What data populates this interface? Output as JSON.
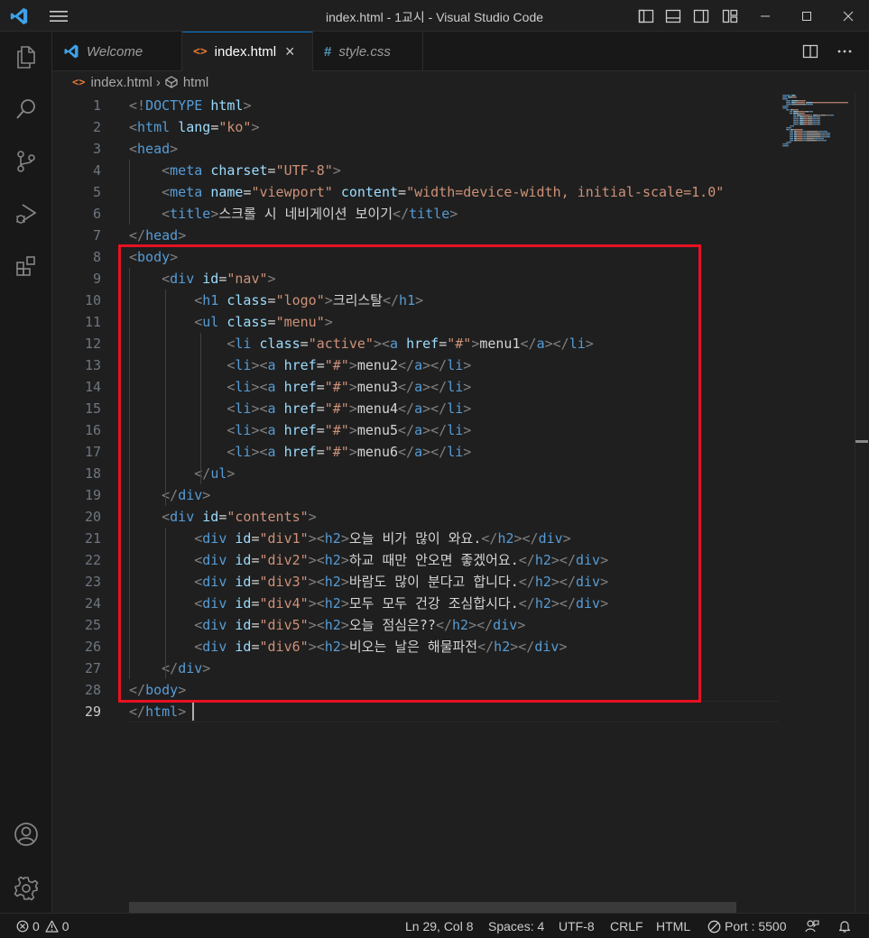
{
  "window": {
    "title": "index.html - 1교시 - Visual Studio Code"
  },
  "tabs": [
    {
      "label": "Welcome",
      "icon": "vscode-icon",
      "active": false
    },
    {
      "label": "index.html",
      "icon": "html-icon",
      "active": true
    },
    {
      "label": "style.css",
      "icon": "css-hash-icon",
      "active": false
    }
  ],
  "breadcrumb": {
    "file": "index.html",
    "symbol": "html"
  },
  "editor": {
    "line_numbers": [
      "1",
      "2",
      "3",
      "4",
      "5",
      "6",
      "7",
      "8",
      "9",
      "10",
      "11",
      "12",
      "13",
      "14",
      "15",
      "16",
      "17",
      "18",
      "19",
      "20",
      "21",
      "22",
      "23",
      "24",
      "25",
      "26",
      "27",
      "28",
      "29"
    ],
    "current_line": "29",
    "lines": [
      [
        [
          "p",
          "<!"
        ],
        [
          "t",
          "DOCTYPE"
        ],
        [
          "x",
          " "
        ],
        [
          "a",
          "html"
        ],
        [
          "p",
          ">"
        ]
      ],
      [
        [
          "p",
          "<"
        ],
        [
          "t",
          "html"
        ],
        [
          "x",
          " "
        ],
        [
          "a",
          "lang"
        ],
        [
          "x",
          "="
        ],
        [
          "s",
          "\"ko\""
        ],
        [
          "p",
          ">"
        ]
      ],
      [
        [
          "p",
          "<"
        ],
        [
          "t",
          "head"
        ],
        [
          "p",
          ">"
        ]
      ],
      [
        [
          "x",
          "    "
        ],
        [
          "p",
          "<"
        ],
        [
          "t",
          "meta"
        ],
        [
          "x",
          " "
        ],
        [
          "a",
          "charset"
        ],
        [
          "x",
          "="
        ],
        [
          "s",
          "\"UTF-8\""
        ],
        [
          "p",
          ">"
        ]
      ],
      [
        [
          "x",
          "    "
        ],
        [
          "p",
          "<"
        ],
        [
          "t",
          "meta"
        ],
        [
          "x",
          " "
        ],
        [
          "a",
          "name"
        ],
        [
          "x",
          "="
        ],
        [
          "s",
          "\"viewport\""
        ],
        [
          "x",
          " "
        ],
        [
          "a",
          "content"
        ],
        [
          "x",
          "="
        ],
        [
          "s",
          "\"width=device-width, initial-scale=1.0\""
        ]
      ],
      [
        [
          "x",
          "    "
        ],
        [
          "p",
          "<"
        ],
        [
          "t",
          "title"
        ],
        [
          "p",
          ">"
        ],
        [
          "x",
          "스크롤 시 네비게이션 보이기"
        ],
        [
          "p",
          "</"
        ],
        [
          "t",
          "title"
        ],
        [
          "p",
          ">"
        ]
      ],
      [
        [
          "p",
          "</"
        ],
        [
          "t",
          "head"
        ],
        [
          "p",
          ">"
        ]
      ],
      [
        [
          "p",
          "<"
        ],
        [
          "t",
          "body"
        ],
        [
          "p",
          ">"
        ]
      ],
      [
        [
          "x",
          "    "
        ],
        [
          "p",
          "<"
        ],
        [
          "t",
          "div"
        ],
        [
          "x",
          " "
        ],
        [
          "a",
          "id"
        ],
        [
          "x",
          "="
        ],
        [
          "s",
          "\"nav\""
        ],
        [
          "p",
          ">"
        ]
      ],
      [
        [
          "x",
          "        "
        ],
        [
          "p",
          "<"
        ],
        [
          "t",
          "h1"
        ],
        [
          "x",
          " "
        ],
        [
          "a",
          "class"
        ],
        [
          "x",
          "="
        ],
        [
          "s",
          "\"logo\""
        ],
        [
          "p",
          ">"
        ],
        [
          "x",
          "크리스탈"
        ],
        [
          "p",
          "</"
        ],
        [
          "t",
          "h1"
        ],
        [
          "p",
          ">"
        ]
      ],
      [
        [
          "x",
          "        "
        ],
        [
          "p",
          "<"
        ],
        [
          "t",
          "ul"
        ],
        [
          "x",
          " "
        ],
        [
          "a",
          "class"
        ],
        [
          "x",
          "="
        ],
        [
          "s",
          "\"menu\""
        ],
        [
          "p",
          ">"
        ]
      ],
      [
        [
          "x",
          "            "
        ],
        [
          "p",
          "<"
        ],
        [
          "t",
          "li"
        ],
        [
          "x",
          " "
        ],
        [
          "a",
          "class"
        ],
        [
          "x",
          "="
        ],
        [
          "s",
          "\"active\""
        ],
        [
          "p",
          "><"
        ],
        [
          "t",
          "a"
        ],
        [
          "x",
          " "
        ],
        [
          "a",
          "href"
        ],
        [
          "x",
          "="
        ],
        [
          "s",
          "\"#\""
        ],
        [
          "p",
          ">"
        ],
        [
          "x",
          "menu1"
        ],
        [
          "p",
          "</"
        ],
        [
          "t",
          "a"
        ],
        [
          "p",
          "></"
        ],
        [
          "t",
          "li"
        ],
        [
          "p",
          ">"
        ]
      ],
      [
        [
          "x",
          "            "
        ],
        [
          "p",
          "<"
        ],
        [
          "t",
          "li"
        ],
        [
          "p",
          "><"
        ],
        [
          "t",
          "a"
        ],
        [
          "x",
          " "
        ],
        [
          "a",
          "href"
        ],
        [
          "x",
          "="
        ],
        [
          "s",
          "\"#\""
        ],
        [
          "p",
          ">"
        ],
        [
          "x",
          "menu2"
        ],
        [
          "p",
          "</"
        ],
        [
          "t",
          "a"
        ],
        [
          "p",
          "></"
        ],
        [
          "t",
          "li"
        ],
        [
          "p",
          ">"
        ]
      ],
      [
        [
          "x",
          "            "
        ],
        [
          "p",
          "<"
        ],
        [
          "t",
          "li"
        ],
        [
          "p",
          "><"
        ],
        [
          "t",
          "a"
        ],
        [
          "x",
          " "
        ],
        [
          "a",
          "href"
        ],
        [
          "x",
          "="
        ],
        [
          "s",
          "\"#\""
        ],
        [
          "p",
          ">"
        ],
        [
          "x",
          "menu3"
        ],
        [
          "p",
          "</"
        ],
        [
          "t",
          "a"
        ],
        [
          "p",
          "></"
        ],
        [
          "t",
          "li"
        ],
        [
          "p",
          ">"
        ]
      ],
      [
        [
          "x",
          "            "
        ],
        [
          "p",
          "<"
        ],
        [
          "t",
          "li"
        ],
        [
          "p",
          "><"
        ],
        [
          "t",
          "a"
        ],
        [
          "x",
          " "
        ],
        [
          "a",
          "href"
        ],
        [
          "x",
          "="
        ],
        [
          "s",
          "\"#\""
        ],
        [
          "p",
          ">"
        ],
        [
          "x",
          "menu4"
        ],
        [
          "p",
          "</"
        ],
        [
          "t",
          "a"
        ],
        [
          "p",
          "></"
        ],
        [
          "t",
          "li"
        ],
        [
          "p",
          ">"
        ]
      ],
      [
        [
          "x",
          "            "
        ],
        [
          "p",
          "<"
        ],
        [
          "t",
          "li"
        ],
        [
          "p",
          "><"
        ],
        [
          "t",
          "a"
        ],
        [
          "x",
          " "
        ],
        [
          "a",
          "href"
        ],
        [
          "x",
          "="
        ],
        [
          "s",
          "\"#\""
        ],
        [
          "p",
          ">"
        ],
        [
          "x",
          "menu5"
        ],
        [
          "p",
          "</"
        ],
        [
          "t",
          "a"
        ],
        [
          "p",
          "></"
        ],
        [
          "t",
          "li"
        ],
        [
          "p",
          ">"
        ]
      ],
      [
        [
          "x",
          "            "
        ],
        [
          "p",
          "<"
        ],
        [
          "t",
          "li"
        ],
        [
          "p",
          "><"
        ],
        [
          "t",
          "a"
        ],
        [
          "x",
          " "
        ],
        [
          "a",
          "href"
        ],
        [
          "x",
          "="
        ],
        [
          "s",
          "\"#\""
        ],
        [
          "p",
          ">"
        ],
        [
          "x",
          "menu6"
        ],
        [
          "p",
          "</"
        ],
        [
          "t",
          "a"
        ],
        [
          "p",
          "></"
        ],
        [
          "t",
          "li"
        ],
        [
          "p",
          ">"
        ]
      ],
      [
        [
          "x",
          "        "
        ],
        [
          "p",
          "</"
        ],
        [
          "t",
          "ul"
        ],
        [
          "p",
          ">"
        ]
      ],
      [
        [
          "x",
          "    "
        ],
        [
          "p",
          "</"
        ],
        [
          "t",
          "div"
        ],
        [
          "p",
          ">"
        ]
      ],
      [
        [
          "x",
          "    "
        ],
        [
          "p",
          "<"
        ],
        [
          "t",
          "div"
        ],
        [
          "x",
          " "
        ],
        [
          "a",
          "id"
        ],
        [
          "x",
          "="
        ],
        [
          "s",
          "\"contents\""
        ],
        [
          "p",
          ">"
        ]
      ],
      [
        [
          "x",
          "        "
        ],
        [
          "p",
          "<"
        ],
        [
          "t",
          "div"
        ],
        [
          "x",
          " "
        ],
        [
          "a",
          "id"
        ],
        [
          "x",
          "="
        ],
        [
          "s",
          "\"div1\""
        ],
        [
          "p",
          "><"
        ],
        [
          "t",
          "h2"
        ],
        [
          "p",
          ">"
        ],
        [
          "x",
          "오늘 비가 많이 와요."
        ],
        [
          "p",
          "</"
        ],
        [
          "t",
          "h2"
        ],
        [
          "p",
          "></"
        ],
        [
          "t",
          "div"
        ],
        [
          "p",
          ">"
        ]
      ],
      [
        [
          "x",
          "        "
        ],
        [
          "p",
          "<"
        ],
        [
          "t",
          "div"
        ],
        [
          "x",
          " "
        ],
        [
          "a",
          "id"
        ],
        [
          "x",
          "="
        ],
        [
          "s",
          "\"div2\""
        ],
        [
          "p",
          "><"
        ],
        [
          "t",
          "h2"
        ],
        [
          "p",
          ">"
        ],
        [
          "x",
          "하교 때만 안오면 좋겠어요."
        ],
        [
          "p",
          "</"
        ],
        [
          "t",
          "h2"
        ],
        [
          "p",
          "></"
        ],
        [
          "t",
          "div"
        ],
        [
          "p",
          ">"
        ]
      ],
      [
        [
          "x",
          "        "
        ],
        [
          "p",
          "<"
        ],
        [
          "t",
          "div"
        ],
        [
          "x",
          " "
        ],
        [
          "a",
          "id"
        ],
        [
          "x",
          "="
        ],
        [
          "s",
          "\"div3\""
        ],
        [
          "p",
          "><"
        ],
        [
          "t",
          "h2"
        ],
        [
          "p",
          ">"
        ],
        [
          "x",
          "바람도 많이 분다고 합니다."
        ],
        [
          "p",
          "</"
        ],
        [
          "t",
          "h2"
        ],
        [
          "p",
          "></"
        ],
        [
          "t",
          "div"
        ],
        [
          "p",
          ">"
        ]
      ],
      [
        [
          "x",
          "        "
        ],
        [
          "p",
          "<"
        ],
        [
          "t",
          "div"
        ],
        [
          "x",
          " "
        ],
        [
          "a",
          "id"
        ],
        [
          "x",
          "="
        ],
        [
          "s",
          "\"div4\""
        ],
        [
          "p",
          "><"
        ],
        [
          "t",
          "h2"
        ],
        [
          "p",
          ">"
        ],
        [
          "x",
          "모두 모두 건강 조심합시다."
        ],
        [
          "p",
          "</"
        ],
        [
          "t",
          "h2"
        ],
        [
          "p",
          "></"
        ],
        [
          "t",
          "div"
        ],
        [
          "p",
          ">"
        ]
      ],
      [
        [
          "x",
          "        "
        ],
        [
          "p",
          "<"
        ],
        [
          "t",
          "div"
        ],
        [
          "x",
          " "
        ],
        [
          "a",
          "id"
        ],
        [
          "x",
          "="
        ],
        [
          "s",
          "\"div5\""
        ],
        [
          "p",
          "><"
        ],
        [
          "t",
          "h2"
        ],
        [
          "p",
          ">"
        ],
        [
          "x",
          "오늘 점심은??"
        ],
        [
          "p",
          "</"
        ],
        [
          "t",
          "h2"
        ],
        [
          "p",
          "></"
        ],
        [
          "t",
          "div"
        ],
        [
          "p",
          ">"
        ]
      ],
      [
        [
          "x",
          "        "
        ],
        [
          "p",
          "<"
        ],
        [
          "t",
          "div"
        ],
        [
          "x",
          " "
        ],
        [
          "a",
          "id"
        ],
        [
          "x",
          "="
        ],
        [
          "s",
          "\"div6\""
        ],
        [
          "p",
          "><"
        ],
        [
          "t",
          "h2"
        ],
        [
          "p",
          ">"
        ],
        [
          "x",
          "비오는 날은 해물파전"
        ],
        [
          "p",
          "</"
        ],
        [
          "t",
          "h2"
        ],
        [
          "p",
          "></"
        ],
        [
          "t",
          "div"
        ],
        [
          "p",
          ">"
        ]
      ],
      [
        [
          "x",
          "    "
        ],
        [
          "p",
          "</"
        ],
        [
          "t",
          "div"
        ],
        [
          "p",
          ">"
        ]
      ],
      [
        [
          "p",
          "</"
        ],
        [
          "t",
          "body"
        ],
        [
          "p",
          ">"
        ]
      ],
      [
        [
          "p",
          "</"
        ],
        [
          "t",
          "html"
        ],
        [
          "p",
          ">"
        ]
      ]
    ]
  },
  "statusbar": {
    "errors": "0",
    "warnings": "0",
    "position": "Ln 29, Col 8",
    "spaces": "Spaces: 4",
    "encoding": "UTF-8",
    "eol": "CRLF",
    "language": "HTML",
    "port": "Port : 5500"
  },
  "colors": {
    "tag": "#569cd6",
    "attribute": "#9cdcfe",
    "string": "#ce9178",
    "punctuation": "#808080",
    "text": "#d4d4d4",
    "highlight_box": "#e81123",
    "accent": "#0078d4"
  }
}
